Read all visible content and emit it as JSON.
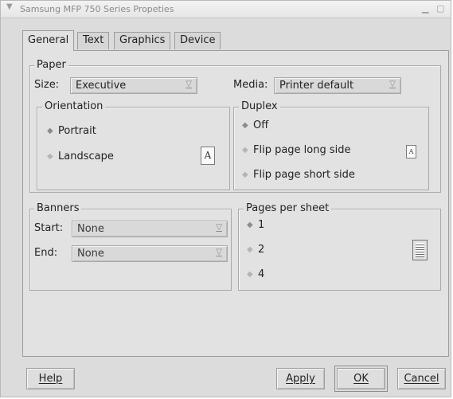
{
  "window": {
    "title": "Samsung MFP 750 Series Propeties",
    "menu_icon": "chevron-down-icon",
    "minimize_icon": "minimize-icon",
    "maximize_icon": "maximize-icon"
  },
  "tabs": [
    {
      "label": "General",
      "active": true
    },
    {
      "label": "Text",
      "active": false
    },
    {
      "label": "Graphics",
      "active": false
    },
    {
      "label": "Device",
      "active": false
    }
  ],
  "paper": {
    "title": "Paper",
    "size_label": "Size:",
    "size_value": "Executive",
    "media_label": "Media:",
    "media_value": "Printer default",
    "orientation": {
      "title": "Orientation",
      "options": [
        {
          "label": "Portrait",
          "selected": true
        },
        {
          "label": "Landscape",
          "selected": false
        }
      ],
      "preview_letter": "A"
    },
    "duplex": {
      "title": "Duplex",
      "options": [
        {
          "label": "Off",
          "selected": true
        },
        {
          "label": "Flip page long side",
          "selected": false
        },
        {
          "label": "Flip page short side",
          "selected": false
        }
      ],
      "preview_letter": "A"
    }
  },
  "banners": {
    "title": "Banners",
    "start_label": "Start:",
    "start_value": "None",
    "end_label": "End:",
    "end_value": "None"
  },
  "pages_per_sheet": {
    "title": "Pages per sheet",
    "options": [
      {
        "label": "1",
        "selected": true
      },
      {
        "label": "2",
        "selected": false
      },
      {
        "label": "4",
        "selected": false
      }
    ]
  },
  "buttons": {
    "help": "Help",
    "apply": "Apply",
    "ok": "OK",
    "cancel": "Cancel"
  },
  "symbols": {
    "dropdown_arrow": "▽",
    "radio": "◆"
  }
}
